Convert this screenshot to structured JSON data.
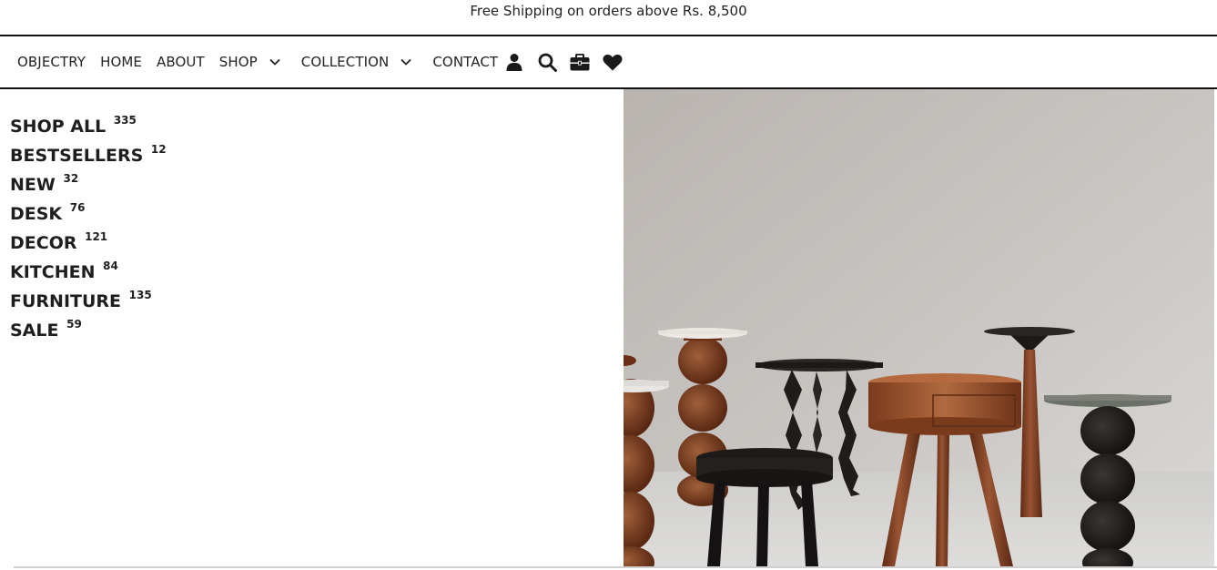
{
  "announcement": {
    "text": "Free Shipping on orders above Rs. 8,500"
  },
  "nav": {
    "brand": "OBJECTRY",
    "home": "HOME",
    "about": "ABOUT",
    "shop": "SHOP",
    "collection": "COLLECTION",
    "contact": "CONTACT",
    "icons": [
      "user-icon",
      "search-icon",
      "briefcase-icon",
      "heart-icon"
    ]
  },
  "categories": [
    {
      "label": "SHOP ALL",
      "count": "335"
    },
    {
      "label": "BESTSELLERS",
      "count": "12"
    },
    {
      "label": "NEW",
      "count": "32"
    },
    {
      "label": "DESK",
      "count": "76"
    },
    {
      "label": "DECOR",
      "count": "121"
    },
    {
      "label": "KITCHEN",
      "count": "84"
    },
    {
      "label": "FURNITURE",
      "count": "135"
    },
    {
      "label": "SALE",
      "count": "59"
    }
  ],
  "colors": {
    "text": "#222222",
    "wood": "#8a4a2a",
    "black": "#1f1c1a",
    "wall": "#c8c4c0"
  }
}
